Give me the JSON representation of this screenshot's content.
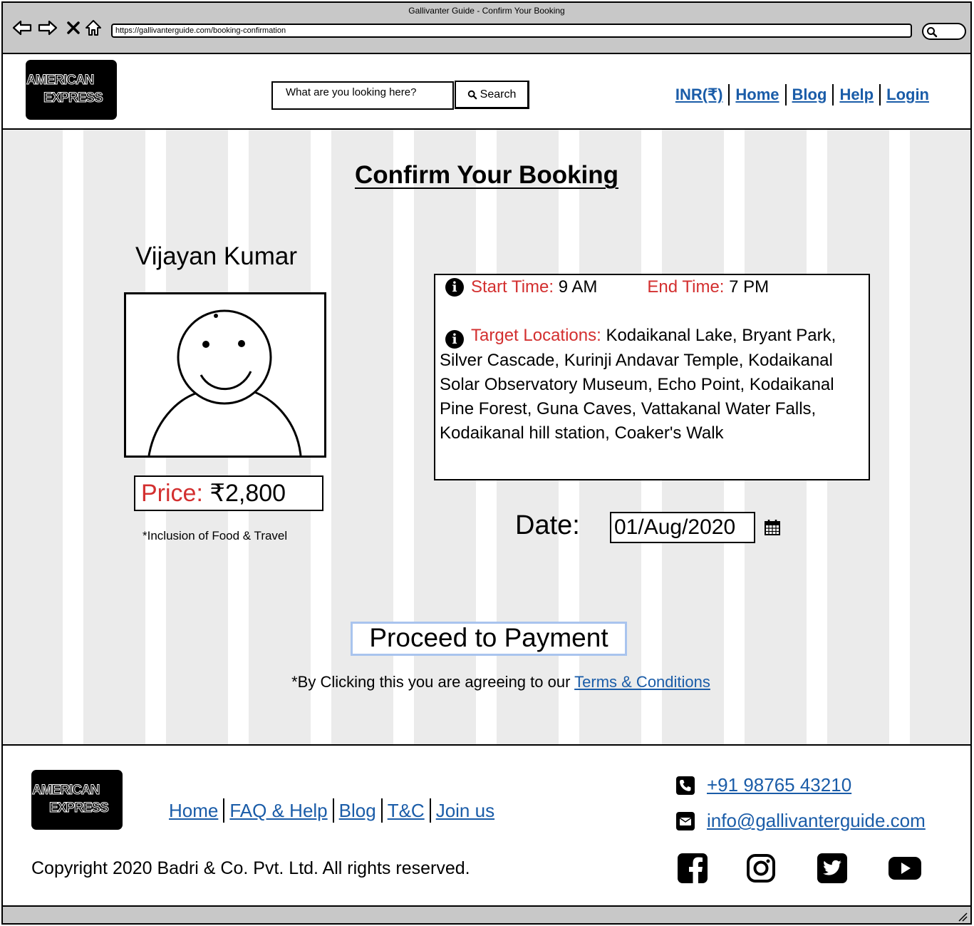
{
  "browser": {
    "window_title": "Gallivanter Guide - Confirm Your Booking",
    "url": "https://gallivanterguide.com/booking-confirmation"
  },
  "logo": {
    "line1": "AMERICAN",
    "line2": "EXPRESS"
  },
  "header": {
    "search_placeholder": "What are you looking here?",
    "search_button": "Search",
    "nav": [
      "INR(₹)",
      "Home",
      "Blog",
      "Help",
      "Login"
    ]
  },
  "main": {
    "title": "Confirm Your Booking",
    "guide_name": "Vijayan Kumar",
    "price_label": "Price:",
    "price_value": "₹2,800",
    "price_note": "*Inclusion of Food & Travel",
    "start_label": "Start Time:",
    "start_value": "9 AM",
    "end_label": "End Time:",
    "end_value": "7 PM",
    "locations_label": "Target Locations:",
    "locations_value": "Kodaikanal Lake, Bryant Park, Silver Cascade, Kurinji Andavar Temple, Kodaikanal Solar Observatory Museum, Echo Point, Kodaikanal Pine Forest, Guna Caves, Vattakanal Water Falls, Kodaikanal hill station, Coaker's Walk",
    "date_label": "Date:",
    "date_value": "01/Aug/2020",
    "pay_button": "Proceed to Payment",
    "terms_prefix": "*By Clicking this you are agreeing to our",
    "terms_link": "Terms & Conditions"
  },
  "footer": {
    "nav": [
      "Home",
      "FAQ & Help",
      "Blog",
      "T&C",
      "Join us"
    ],
    "phone": "+91 98765 43210",
    "email": "info@gallivanterguide.com",
    "copyright": "Copyright 2020 Badri & Co. Pvt. Ltd. All rights reserved.",
    "social_icons": [
      "facebook-icon",
      "instagram-icon",
      "twitter-icon",
      "youtube-icon"
    ]
  },
  "colors": {
    "link": "#1a5ca8",
    "label_red": "#d32f2f",
    "background_stripe": "#ebebeb"
  }
}
